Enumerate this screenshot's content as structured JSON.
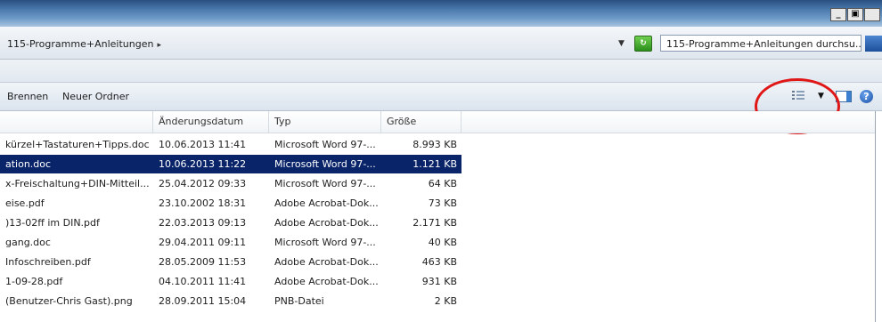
{
  "window": {
    "restore_label": "_",
    "maximize_label": "b",
    "close_label": ""
  },
  "address": {
    "breadcrumb": "115-Programme+Anleitungen",
    "breadcrumb_arrow": "▸",
    "dropdown_arrow": "▼",
    "search_placeholder": "115-Programme+Anleitungen durchsu..."
  },
  "toolbar": {
    "burn_label": "Brennen",
    "new_folder_label": "Neuer Ordner",
    "view_dropdown_arrow": "▼",
    "help_label": "?"
  },
  "columns": {
    "date": "Änderungsdatum",
    "type": "Typ",
    "size": "Größe"
  },
  "files": [
    {
      "name": "kürzel+Tastaturen+Tipps.doc",
      "date": "10.06.2013 11:41",
      "type": "Microsoft Word 97-...",
      "size": "8.993 KB",
      "selected": false
    },
    {
      "name": "ation.doc",
      "date": "10.06.2013 11:22",
      "type": "Microsoft Word 97-...",
      "size": "1.121 KB",
      "selected": true
    },
    {
      "name": "x-Freischaltung+DIN-Mitteil...",
      "date": "25.04.2012 09:33",
      "type": "Microsoft Word 97-...",
      "size": "64 KB",
      "selected": false
    },
    {
      "name": "eise.pdf",
      "date": "23.10.2002 18:31",
      "type": "Adobe Acrobat-Dok...",
      "size": "73 KB",
      "selected": false
    },
    {
      "name": ")13-02ff im DIN.pdf",
      "date": "22.03.2013 09:13",
      "type": "Adobe Acrobat-Dok...",
      "size": "2.171 KB",
      "selected": false
    },
    {
      "name": "gang.doc",
      "date": "29.04.2011 09:11",
      "type": "Microsoft Word 97-...",
      "size": "40 KB",
      "selected": false
    },
    {
      "name": "Infoschreiben.pdf",
      "date": "28.05.2009 11:53",
      "type": "Adobe Acrobat-Dok...",
      "size": "463 KB",
      "selected": false
    },
    {
      "name": "1-09-28.pdf",
      "date": "04.10.2011 11:41",
      "type": "Adobe Acrobat-Dok...",
      "size": "931 KB",
      "selected": false
    },
    {
      "name": "(Benutzer-Chris Gast).png",
      "date": "28.09.2011 15:04",
      "type": "PNB-Datei",
      "size": "2 KB",
      "selected": false
    }
  ],
  "colors": {
    "selection": "#0a246a",
    "highlight_circle": "#e01717",
    "title_bar": "#4a79ad"
  }
}
